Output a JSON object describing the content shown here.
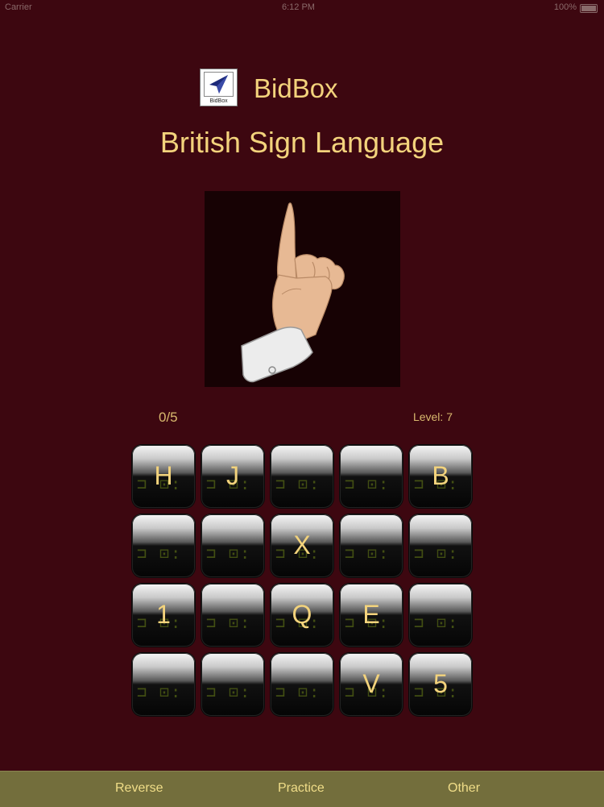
{
  "status_bar": {
    "carrier": "Carrier",
    "time": "6:12 PM",
    "battery": "100%"
  },
  "header": {
    "app_name": "BidBox",
    "logo_text": "BidBox",
    "subtitle": "British Sign Language"
  },
  "sign_image": {
    "icon": "pointing-hand-icon"
  },
  "progress": {
    "score": "0/5",
    "level": "Level: 7"
  },
  "tiles": [
    "H",
    "J",
    "",
    "",
    "B",
    "",
    "",
    "X",
    "",
    "",
    "1",
    "",
    "Q",
    "E",
    "",
    "",
    "",
    "",
    "V",
    "5"
  ],
  "tab_bar": {
    "reverse": "Reverse",
    "practice": "Practice",
    "other": "Other"
  },
  "colors": {
    "background": "#3d0710",
    "accent_text": "#f3d37c",
    "tab_bar": "#736e3c"
  }
}
